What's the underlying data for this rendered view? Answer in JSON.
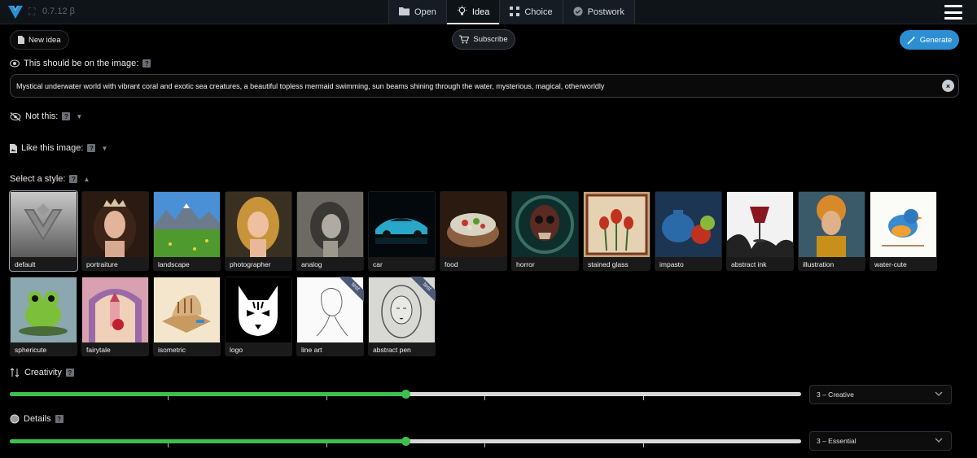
{
  "topbar": {
    "version": "0.7.12 β",
    "tabs": [
      {
        "label": "Open",
        "icon": "folder-icon"
      },
      {
        "label": "Idea",
        "icon": "lightbulb-icon"
      },
      {
        "label": "Choice",
        "icon": "grid-icon"
      },
      {
        "label": "Postwork",
        "icon": "check-circle-icon"
      }
    ],
    "active_tab": "Idea"
  },
  "actions": {
    "new_idea": "New idea",
    "subscribe": "Subscribe",
    "generate": "Generate"
  },
  "positive": {
    "label": "This should be on the image:",
    "value": "Mystical underwater world with vibrant coral and exotic sea creatures, a beautiful topless mermaid swimming, sun beams shining through the water, mysterious, magical, otherworldly"
  },
  "negative": {
    "label": "Not this:"
  },
  "like_image": {
    "label": "Like this image:"
  },
  "styles": {
    "label": "Select a style:",
    "selected": "default",
    "items": [
      {
        "label": "default",
        "tag": ""
      },
      {
        "label": "portraiture",
        "tag": ""
      },
      {
        "label": "landscape",
        "tag": ""
      },
      {
        "label": "photographer",
        "tag": ""
      },
      {
        "label": "analog",
        "tag": ""
      },
      {
        "label": "car",
        "tag": ""
      },
      {
        "label": "food",
        "tag": ""
      },
      {
        "label": "horror",
        "tag": ""
      },
      {
        "label": "stained glass",
        "tag": ""
      },
      {
        "label": "impasto",
        "tag": ""
      },
      {
        "label": "abstract ink",
        "tag": ""
      },
      {
        "label": "illustration",
        "tag": ""
      },
      {
        "label": "water-cute",
        "tag": ""
      },
      {
        "label": "sphericute",
        "tag": ""
      },
      {
        "label": "fairytale",
        "tag": ""
      },
      {
        "label": "isometric",
        "tag": ""
      },
      {
        "label": "logo",
        "tag": ""
      },
      {
        "label": "line art",
        "tag": "test"
      },
      {
        "label": "abstract pen",
        "tag": "test"
      }
    ]
  },
  "creativity": {
    "label": "Creativity",
    "value_label": "3 – Creative",
    "level": 0.5,
    "ticks": 5
  },
  "details": {
    "label": "Details",
    "value_label": "3 – Essential",
    "level": 0.5,
    "ticks": 5
  },
  "colors": {
    "accent": "#2d8fd3",
    "slider": "#3fbf4f",
    "background": "#000000"
  }
}
